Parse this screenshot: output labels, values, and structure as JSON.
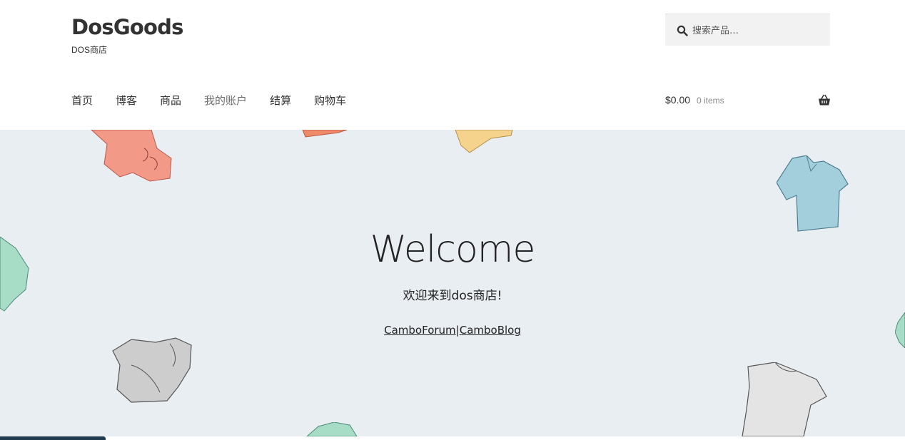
{
  "site": {
    "title": "DosGoods",
    "description": "DOS商店"
  },
  "search": {
    "placeholder": "搜索产品…",
    "icon": "search-icon"
  },
  "nav": {
    "items": [
      {
        "label": "首页"
      },
      {
        "label": "博客"
      },
      {
        "label": "商品"
      },
      {
        "label": "我的账户",
        "active": true
      },
      {
        "label": "结算"
      },
      {
        "label": "购物车"
      }
    ]
  },
  "cart": {
    "amount": "$0.00",
    "count": "0 items",
    "icon": "basket-icon"
  },
  "hero": {
    "title": "Welcome",
    "subtitle": "欢迎来到dos商店!",
    "link1": "CamboForum",
    "separator": "|",
    "link2": "CamboBlog"
  },
  "colors": {
    "hero_bg": "#e9eef3",
    "text": "#333333",
    "active_nav": "#6d6d6d",
    "search_bg": "#f2f2f2"
  }
}
